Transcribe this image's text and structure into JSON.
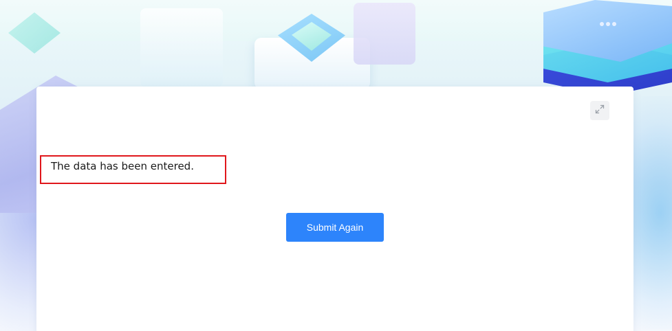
{
  "card": {
    "message": "The data has been entered.",
    "submit_again_label": "Submit Again",
    "expand_icon": "expand-icon"
  },
  "colors": {
    "primary_button": "#2d84fb",
    "highlight_border": "#e0161b",
    "card_background": "#ffffff"
  }
}
